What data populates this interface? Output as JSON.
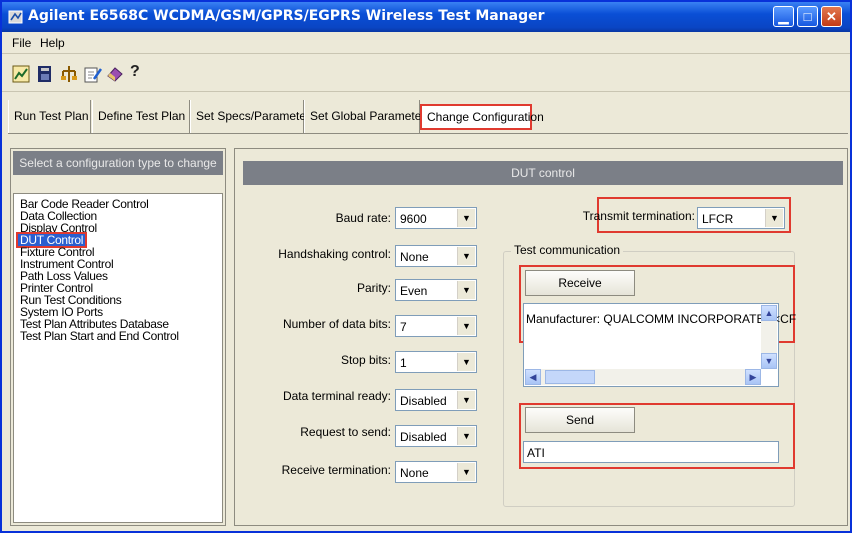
{
  "window": {
    "title": "Agilent E6568C WCDMA/GSM/GPRS/EGPRS Wireless Test Manager"
  },
  "menu": [
    "File",
    "Help"
  ],
  "toolbar_icons": [
    "chart-icon",
    "book-icon",
    "tree-icon",
    "edit-icon",
    "eraser-icon",
    "help-icon"
  ],
  "tabs": [
    "Run Test Plan",
    "Define Test Plan",
    "Set Specs/Parameters",
    "Set Global Parameters",
    "Change Configuration"
  ],
  "active_tab": "Change Configuration",
  "config_panel": {
    "header": "Select a configuration type to change",
    "items": [
      "Bar Code Reader Control",
      "Data Collection",
      "Display Control",
      "DUT Control",
      "Fixture Control",
      "Instrument Control",
      "Path Loss Values",
      "Printer Control",
      "Run Test Conditions",
      "System IO Ports",
      "Test Plan Attributes Database",
      "Test Plan Start and End Control"
    ],
    "selected": "DUT Control"
  },
  "dut": {
    "header": "DUT control",
    "fields": [
      {
        "label": "Baud rate:",
        "value": "9600"
      },
      {
        "label": "Handshaking control:",
        "value": "None"
      },
      {
        "label": "Parity:",
        "value": "Even"
      },
      {
        "label": "Number of data bits:",
        "value": "7"
      },
      {
        "label": "Stop bits:",
        "value": "1"
      },
      {
        "label": "Data terminal ready:",
        "value": "Disabled"
      },
      {
        "label": "Request to send:",
        "value": "Disabled"
      },
      {
        "label": "Receive termination:",
        "value": "None"
      }
    ],
    "transmit_termination": {
      "label": "Transmit termination:",
      "value": "LFCR"
    },
    "test_comm": {
      "label": "Test communication",
      "receive_button": "Receive",
      "received_text": "Manufacturer: QUALCOMM INCORPORATED<CF",
      "send_button": "Send",
      "send_text": "ATI"
    }
  },
  "colors": {
    "title_bar": "#0a4fd6",
    "highlight_box": "#e03a2f",
    "selection": "#2a5fd0",
    "panel_header": "#7b7f87"
  }
}
